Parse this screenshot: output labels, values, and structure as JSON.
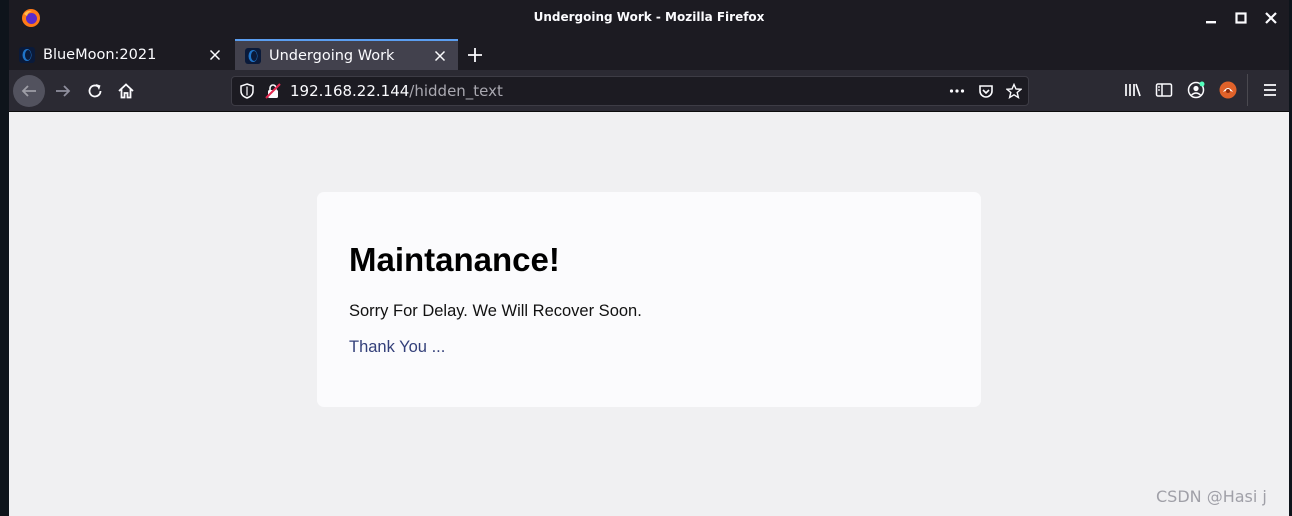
{
  "window": {
    "title": "Undergoing Work - Mozilla Firefox"
  },
  "tabs": [
    {
      "label": "BlueMoon:2021",
      "active": false
    },
    {
      "label": "Undergoing Work",
      "active": true
    }
  ],
  "urlbar": {
    "host": "192.168.22.144",
    "path": "/hidden_text"
  },
  "page": {
    "heading": "Maintanance!",
    "message": "Sorry For Delay. We Will Recover Soon.",
    "thanks": "Thank You ..."
  },
  "watermark": "CSDN @Hasi j",
  "colors": {
    "accent": "#5b9ef0",
    "page_bg": "#f0f0f2",
    "link": "#34407a"
  },
  "icons": [
    "firefox-logo-icon",
    "minimize-icon",
    "maximize-icon",
    "close-window-icon",
    "favicon-icon",
    "close-tab-icon",
    "new-tab-icon",
    "back-icon",
    "forward-icon",
    "reload-icon",
    "home-icon",
    "shield-icon",
    "insecure-lock-icon",
    "more-icon",
    "pocket-icon",
    "bookmark-star-icon",
    "library-icon",
    "sidebar-icon",
    "account-icon",
    "extension-icon",
    "menu-icon"
  ]
}
